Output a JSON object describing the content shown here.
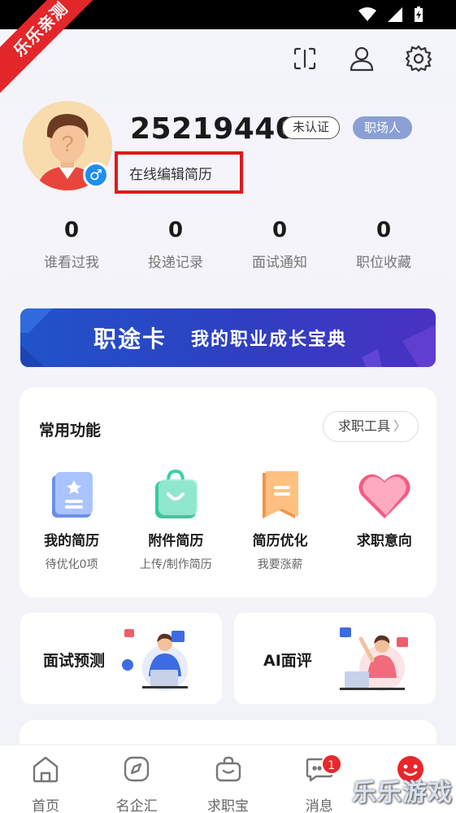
{
  "ribbon": "乐乐亲测",
  "profile": {
    "user_id": "25219440",
    "verify_badge": "未认证",
    "role_badge": "职场人",
    "edit_resume": "在线编辑简历",
    "gender_symbol": "♂"
  },
  "stats": [
    {
      "value": "0",
      "label": "谁看过我"
    },
    {
      "value": "0",
      "label": "投递记录"
    },
    {
      "value": "0",
      "label": "面试通知"
    },
    {
      "value": "0",
      "label": "职位收藏"
    }
  ],
  "banner": {
    "title": "职途卡",
    "subtitle": "我的职业成长宝典"
  },
  "common": {
    "title": "常用功能",
    "tools_button": "求职工具",
    "features": [
      {
        "name": "我的简历",
        "sub": "待优化0项",
        "icon": "resume-icon"
      },
      {
        "name": "附件简历",
        "sub": "上传/制作简历",
        "icon": "attachment-bag-icon"
      },
      {
        "name": "简历优化",
        "sub": "我要涨薪",
        "icon": "optimize-icon"
      },
      {
        "name": "求职意向",
        "sub": "",
        "icon": "heart-icon"
      }
    ]
  },
  "tiles": [
    {
      "label": "面试预测"
    },
    {
      "label": "AI面评"
    }
  ],
  "tabs": [
    {
      "label": "首页",
      "icon": "home-icon"
    },
    {
      "label": "名企汇",
      "icon": "compass-icon"
    },
    {
      "label": "求职宝",
      "icon": "bag-icon"
    },
    {
      "label": "消息",
      "icon": "message-icon",
      "badge": "1"
    },
    {
      "label": "",
      "icon": "mascot-icon"
    }
  ],
  "watermark": "乐乐游戏",
  "colors": {
    "accent": "#2053c9",
    "badge_role": "#8a9fd4",
    "highlight": "#e3171b",
    "notification": "#e9262a"
  }
}
